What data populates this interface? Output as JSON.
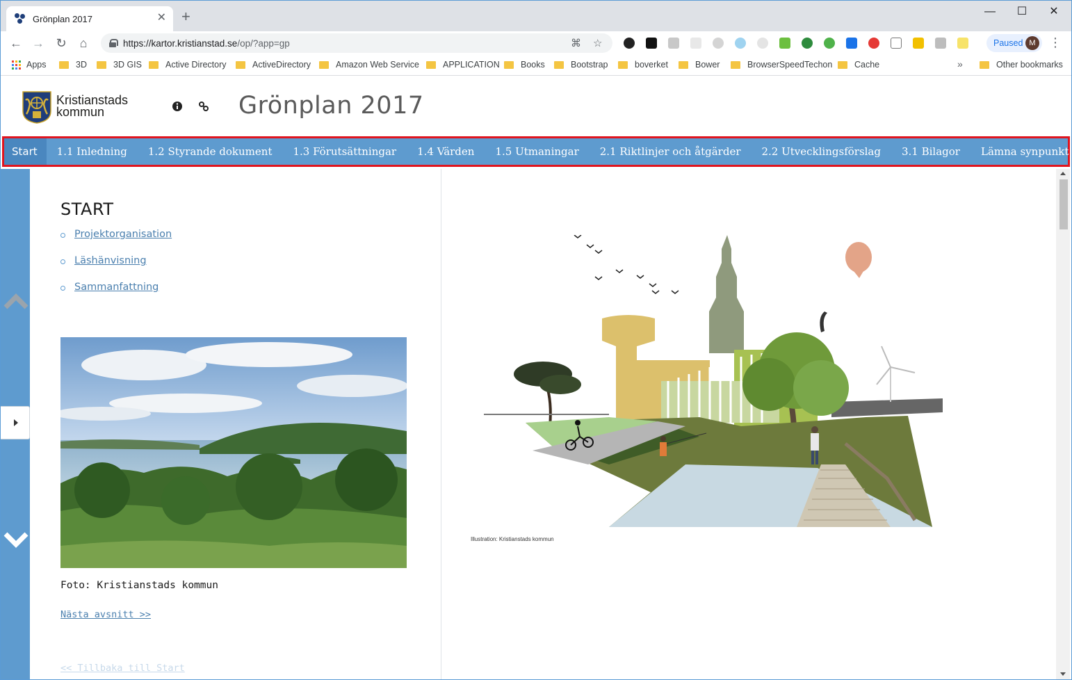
{
  "browser": {
    "tab_title": "Grönplan 2017",
    "tab_close": "✕",
    "new_tab": "+",
    "url_host": "https://kartor.kristianstad.se",
    "url_path": "/op/?app=gp",
    "profile_label": "Paused",
    "profile_initial": "M",
    "bookmarks": [
      "Apps",
      "3D",
      "3D GIS",
      "Active Directory",
      "ActiveDirectory",
      "Amazon Web Service",
      "APPLICATION",
      "Books",
      "Bootstrap",
      "boverket",
      "Bower",
      "BrowserSpeedTechon",
      "Cache"
    ],
    "bookmarks_more": "»",
    "other_bookmarks": "Other bookmarks"
  },
  "header": {
    "logo_line1": "Kristianstads",
    "logo_line2": "kommun",
    "title": "Grönplan 2017"
  },
  "nav": {
    "items": [
      {
        "label": "Start",
        "active": true
      },
      {
        "label": "1.1 Inledning"
      },
      {
        "label": "1.2 Styrande dokument"
      },
      {
        "label": "1.3 Förutsättningar"
      },
      {
        "label": "1.4 Värden"
      },
      {
        "label": "1.5 Utmaningar"
      },
      {
        "label": "2.1 Riktlinjer och åtgärder"
      },
      {
        "label": "2.2 Utvecklingsförslag"
      },
      {
        "label": "3.1 Bilagor"
      },
      {
        "label": "Lämna synpunkt"
      }
    ]
  },
  "content": {
    "heading": "START",
    "toc": [
      "Projektorganisation",
      "Läshänvisning",
      "Sammanfattning"
    ],
    "photo_caption": "Foto: Kristianstads kommun",
    "next_link": "Nästa avsnitt >>",
    "back_link": "<< Tillbaka till Start",
    "illustration_credit": "Illustration: Kristianstads kommun"
  },
  "colors": {
    "nav_bg": "#5e9bcf",
    "nav_active": "#4a87bf",
    "highlight_border": "#e0141e",
    "link": "#4a7fae"
  }
}
